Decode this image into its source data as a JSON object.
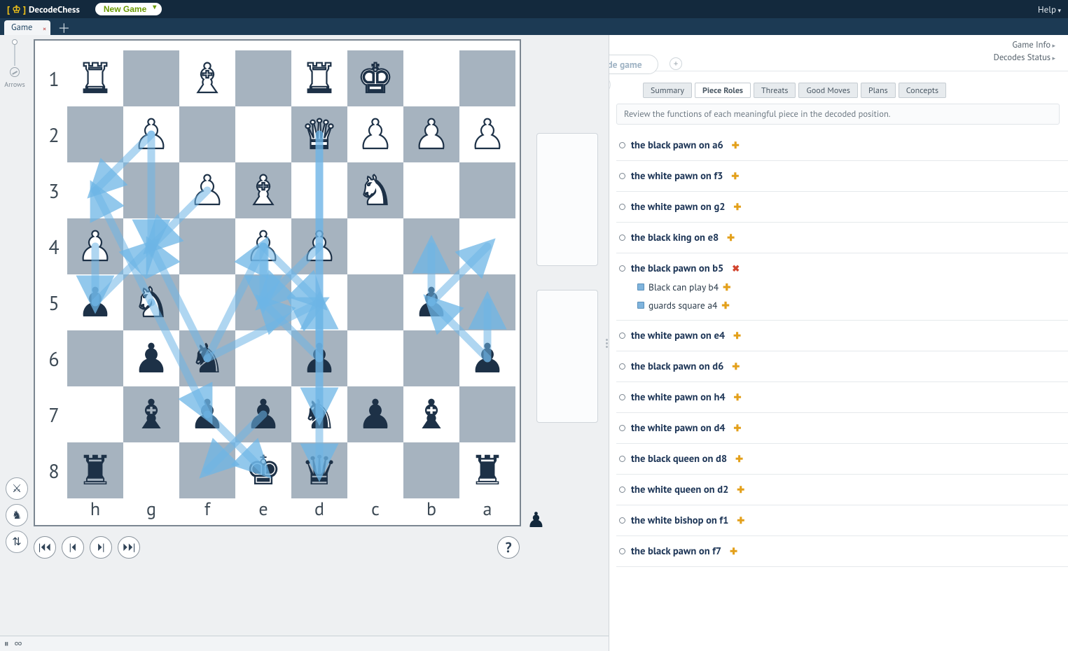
{
  "app": {
    "name": "DecodeChess",
    "new_game": "New Game",
    "help": "Help"
  },
  "tabs": [
    {
      "label": "Game"
    }
  ],
  "arrows_gutter": {
    "label": "Arrows"
  },
  "rank_labels": [
    "1",
    "2",
    "3",
    "4",
    "5",
    "6",
    "7",
    "8"
  ],
  "file_labels": [
    "h",
    "g",
    "f",
    "e",
    "d",
    "c",
    "b",
    "a"
  ],
  "board": {
    "orientation": "flipped_h_to_a_top_rank_1",
    "pieces": [
      {
        "sq": "h1",
        "c": "w",
        "t": "R"
      },
      {
        "sq": "f1",
        "c": "w",
        "t": "B"
      },
      {
        "sq": "d1",
        "c": "w",
        "t": "R"
      },
      {
        "sq": "c1",
        "c": "w",
        "t": "K"
      },
      {
        "sq": "g2",
        "c": "w",
        "t": "P"
      },
      {
        "sq": "d2",
        "c": "w",
        "t": "Q"
      },
      {
        "sq": "c2",
        "c": "w",
        "t": "P"
      },
      {
        "sq": "b2",
        "c": "w",
        "t": "P"
      },
      {
        "sq": "a2",
        "c": "w",
        "t": "P"
      },
      {
        "sq": "f3",
        "c": "w",
        "t": "P"
      },
      {
        "sq": "e3",
        "c": "w",
        "t": "B"
      },
      {
        "sq": "c3",
        "c": "w",
        "t": "N"
      },
      {
        "sq": "h4",
        "c": "w",
        "t": "P"
      },
      {
        "sq": "e4",
        "c": "w",
        "t": "P"
      },
      {
        "sq": "d4",
        "c": "w",
        "t": "P"
      },
      {
        "sq": "h5",
        "c": "b",
        "t": "P"
      },
      {
        "sq": "g5",
        "c": "w",
        "t": "N"
      },
      {
        "sq": "b5",
        "c": "b",
        "t": "P"
      },
      {
        "sq": "g6",
        "c": "b",
        "t": "P"
      },
      {
        "sq": "f6",
        "c": "b",
        "t": "N"
      },
      {
        "sq": "d6",
        "c": "b",
        "t": "P"
      },
      {
        "sq": "a6",
        "c": "b",
        "t": "P"
      },
      {
        "sq": "g7",
        "c": "b",
        "t": "B"
      },
      {
        "sq": "f7",
        "c": "b",
        "t": "P"
      },
      {
        "sq": "e7",
        "c": "b",
        "t": "P"
      },
      {
        "sq": "d7",
        "c": "b",
        "t": "N"
      },
      {
        "sq": "c7",
        "c": "b",
        "t": "P"
      },
      {
        "sq": "b7",
        "c": "b",
        "t": "B"
      },
      {
        "sq": "h8",
        "c": "b",
        "t": "R"
      },
      {
        "sq": "e8",
        "c": "b",
        "t": "K"
      },
      {
        "sq": "d8",
        "c": "b",
        "t": "Q"
      },
      {
        "sq": "a8",
        "c": "b",
        "t": "R"
      }
    ],
    "arrows": [
      {
        "from": "g2",
        "to": "g4"
      },
      {
        "from": "g2",
        "to": "h3"
      },
      {
        "from": "g5",
        "to": "f7"
      },
      {
        "from": "g5",
        "to": "h3"
      },
      {
        "from": "f3",
        "to": "g4"
      },
      {
        "from": "d4",
        "to": "e5"
      },
      {
        "from": "e4",
        "to": "d5"
      },
      {
        "from": "e4",
        "to": "e5"
      },
      {
        "from": "d2",
        "to": "d8"
      },
      {
        "from": "d2",
        "to": "d7"
      },
      {
        "from": "h4",
        "to": "h5"
      },
      {
        "from": "h5",
        "to": "g4"
      },
      {
        "from": "b5",
        "to": "a4"
      },
      {
        "from": "b5",
        "to": "b4"
      },
      {
        "from": "a6",
        "to": "a5"
      },
      {
        "from": "a6",
        "to": "b5"
      },
      {
        "from": "f6",
        "to": "e4"
      },
      {
        "from": "f6",
        "to": "d5"
      },
      {
        "from": "f6",
        "to": "g4"
      },
      {
        "from": "f7",
        "to": "e8"
      },
      {
        "from": "e7",
        "to": "f8"
      },
      {
        "from": "d6",
        "to": "e5"
      },
      {
        "from": "d6",
        "to": "d5"
      }
    ]
  },
  "nav": {
    "first": "⏮",
    "prev": "◀",
    "next": "▶",
    "last": "⏭",
    "help": "?"
  },
  "turn_indicator": "♟",
  "bottom_icons": [
    "⏸",
    "∞"
  ],
  "right": {
    "links": {
      "game_info": "Game Info",
      "decodes_status": "Decodes Status"
    },
    "decode_pill": "Decode game",
    "tabs": [
      "Summary",
      "Piece Roles",
      "Threats",
      "Good Moves",
      "Plans",
      "Concepts"
    ],
    "active_tab": 1,
    "tab_desc": "Review the functions of each meaningful piece in the decoded position.",
    "roles": [
      {
        "title": "the black pawn on a6",
        "mark": "+"
      },
      {
        "title": "the white pawn on f3",
        "mark": "+"
      },
      {
        "title": "the white pawn on g2",
        "mark": "+"
      },
      {
        "title": "the black king on e8",
        "mark": "+"
      },
      {
        "title": "the black pawn on b5",
        "mark": "x",
        "subs": [
          {
            "text": "Black can play  b4",
            "tail": "+"
          },
          {
            "text": "guards square a4",
            "tail": "+"
          }
        ]
      },
      {
        "title": "the white pawn on e4",
        "mark": "+"
      },
      {
        "title": "the black pawn on d6",
        "mark": "+"
      },
      {
        "title": "the white pawn on h4",
        "mark": "+"
      },
      {
        "title": "the white pawn on d4",
        "mark": "+"
      },
      {
        "title": "the black queen on d8",
        "mark": "+"
      },
      {
        "title": "the white queen on d2",
        "mark": "+"
      },
      {
        "title": "the white bishop on f1",
        "mark": "+"
      },
      {
        "title": "the black pawn on f7",
        "mark": "+"
      }
    ]
  }
}
